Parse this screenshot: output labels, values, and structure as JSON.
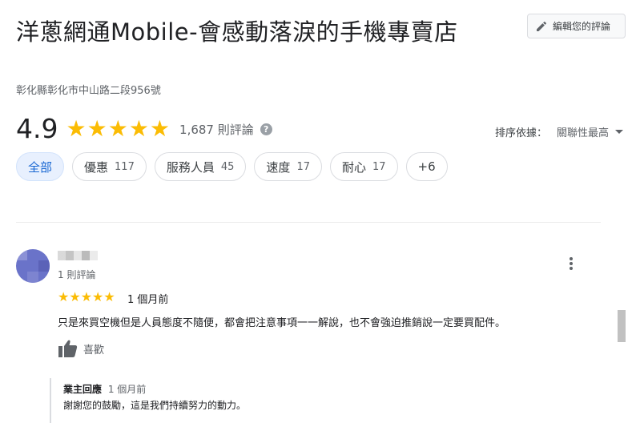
{
  "place": {
    "title": "洋蔥網通Mobile-會感動落淚的手機專賣店",
    "address": "彰化縣彰化市中山路二段956號"
  },
  "edit": {
    "label": "編輯您的評論",
    "icon": "pencil-icon"
  },
  "rating": {
    "value": "4.9",
    "stars": 5,
    "count_label": "1,687 則評論",
    "help_icon": "?"
  },
  "sort": {
    "label": "排序依據：",
    "value": "關聯性最高"
  },
  "chips": [
    {
      "label": "全部",
      "count": ""
    },
    {
      "label": "優惠",
      "count": "117"
    },
    {
      "label": "服務人員",
      "count": "45"
    },
    {
      "label": "速度",
      "count": "17"
    },
    {
      "label": "耐心",
      "count": "17"
    },
    {
      "label": "+6",
      "count": ""
    }
  ],
  "review": {
    "reviewer_count": "1 則評論",
    "stars": 5,
    "time": "1 個月前",
    "text": "只是來買空機但是人員態度不隨便，都會把注意事項一一解說，也不會強迫推銷說一定要買配件。",
    "like_label": "喜歡",
    "owner": {
      "label": "業主回應",
      "time": "1 個月前",
      "text": "謝謝您的鼓勵，這是我們持續努力的動力。"
    }
  },
  "colors": {
    "star": "#fbbc04",
    "active_chip_bg": "#e8f0fe",
    "active_chip_text": "#1967d2"
  }
}
